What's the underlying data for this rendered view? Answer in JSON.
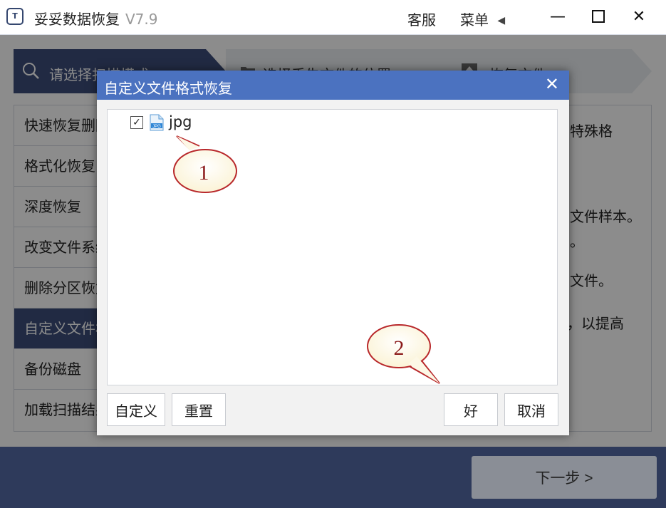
{
  "app": {
    "title": "妥妥数据恢复",
    "version": "V7.9",
    "logo_text": "T"
  },
  "titlebar": {
    "service": "客服",
    "menu": "菜单",
    "menu_arrow": "◀",
    "minimize": "—",
    "close": "✕"
  },
  "steps": [
    {
      "label": "请选择扫描模式"
    },
    {
      "label": "选择丢失文件的位置"
    },
    {
      "label": "恢复文件"
    }
  ],
  "modes": [
    {
      "label": "快速恢复删除的文件"
    },
    {
      "label": "格式化恢复"
    },
    {
      "label": "深度恢复"
    },
    {
      "label": "改变文件系统恢复"
    },
    {
      "label": "删除分区恢复"
    },
    {
      "label": "自定义文件格式恢复",
      "selected": true
    },
    {
      "label": "备份磁盘"
    },
    {
      "label": "加载扫描结果"
    }
  ],
  "desc_lines": [
    "特殊格",
    "文件样本。",
    "。",
    "文件。",
    "，以提高"
  ],
  "next_button": "下一步 >",
  "dialog": {
    "title": "自定义文件格式恢复",
    "close": "✕",
    "items": [
      {
        "label": "jpg",
        "checked": true,
        "check_glyph": "✓",
        "icon": "jpg-file-icon",
        "icon_text": "JPG"
      }
    ],
    "buttons": {
      "custom": "自定义",
      "reset": "重置",
      "ok": "好",
      "cancel": "取消"
    }
  },
  "callouts": [
    {
      "label": "1"
    },
    {
      "label": "2"
    }
  ],
  "colors": {
    "accent": "#3c4d7b",
    "dialog_title": "#4b72c0",
    "callout_fill": "#fffbe8",
    "callout_stroke": "#b8272a"
  }
}
